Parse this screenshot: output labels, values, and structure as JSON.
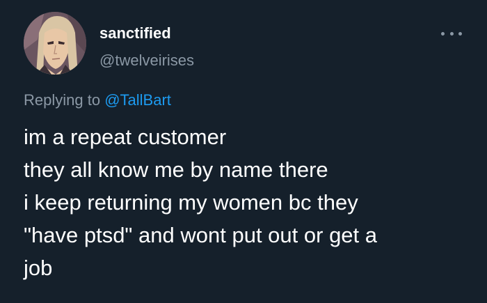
{
  "author": {
    "display_name": "sanctified",
    "handle": "@twelveirises",
    "avatar_icon": "anime-character-portrait"
  },
  "reply": {
    "prefix": "Replying to ",
    "target": "@TallBart"
  },
  "tweet": {
    "lines": [
      "im a repeat customer",
      "they all know me by name there",
      "i keep returning my women bc they",
      "\"have ptsd\" and wont put out or get a",
      "job"
    ]
  },
  "colors": {
    "background": "#15202b",
    "primary_text": "#ffffff",
    "secondary_text": "#8b98a5",
    "link": "#1d9bf0"
  }
}
